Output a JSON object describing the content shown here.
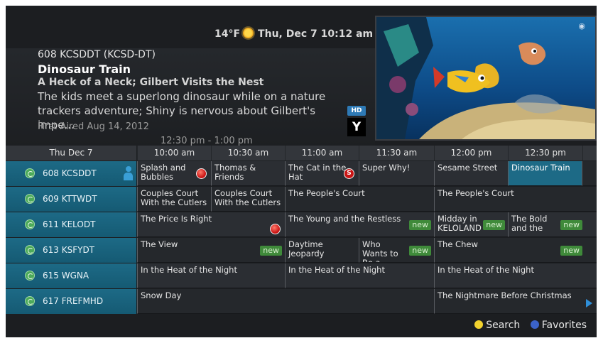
{
  "header": {
    "temperature": "14°F",
    "datetime": "Thu, Dec 7 10:12 am",
    "weather_icon": "sun-icon"
  },
  "info": {
    "channel": "608 KCSDDT (KCSD-DT)",
    "title": "Dinosaur Train",
    "episode": "A Heck of a Neck; Gilbert Visits the Nest",
    "description": "The kids meet a superlong dinosaur while on a nature trackers adventure; Shiny is nervous about Gilbert's impe...",
    "first_aired": "First Aired Aug 14, 2012",
    "time_slot": "12:30 pm - 1:00 pm",
    "hd_badge": "HD",
    "rating_badge": "Y"
  },
  "grid": {
    "date_label": "Thu Dec 7",
    "times": [
      "10:00 am",
      "10:30 am",
      "11:00 am",
      "11:30 am",
      "12:00 pm",
      "12:30 pm"
    ],
    "channels": [
      {
        "label": "608 KCSDDT"
      },
      {
        "label": "609 KTTWDT"
      },
      {
        "label": "611 KELODT"
      },
      {
        "label": "613 KSFYDT"
      },
      {
        "label": "615 WGNA"
      },
      {
        "label": "617 FREFMHD"
      }
    ],
    "programs": {
      "r0": [
        "Splash and Bubbles",
        "Thomas & Friends",
        "The Cat in the Hat",
        "Super Why!",
        "Sesame Street",
        "Dinosaur Train"
      ],
      "r1": [
        "Couples Court With the Cutlers",
        "Couples Court With the Cutlers",
        "The People's Court",
        "The People's Court"
      ],
      "r2": [
        "The Price Is Right",
        "The Young and the Restless",
        "Midday in KELOLAND",
        "The Bold and the"
      ],
      "r3": [
        "The View",
        "Daytime Jeopardy",
        "Who Wants to Be a",
        "The Chew"
      ],
      "r4": [
        "In the Heat of the Night",
        "In the Heat of the Night",
        "In the Heat of the Night"
      ],
      "r5": [
        "Snow Day",
        "The Nightmare Before Christmas"
      ]
    },
    "new_badge": "new",
    "series_badge": "S"
  },
  "footer": {
    "search_label": "Search",
    "favorites_label": "Favorites",
    "search_color": "#f2d22e",
    "favorites_color": "#3b63c9"
  }
}
